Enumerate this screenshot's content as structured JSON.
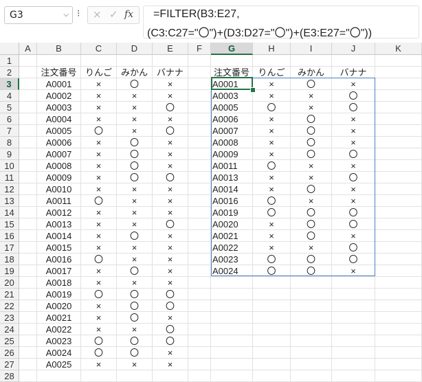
{
  "name_box": {
    "value": "G3",
    "chevron": "chevron-down-icon"
  },
  "formula_bar": {
    "menu_icon": "⁝",
    "cancel_icon": "×",
    "enter_icon": "✓",
    "fx_icon": "fx",
    "line1": "=FILTER(B3:E27,",
    "line2": "(C3:C27=\"〇\")+(D3:D27=\"〇\")+(E3:E27=\"〇\"))"
  },
  "column_headers": [
    "A",
    "B",
    "C",
    "D",
    "E",
    "F",
    "G",
    "H",
    "I",
    "J",
    "K"
  ],
  "selected_column": "G",
  "row_numbers": [
    "1",
    "2",
    "3",
    "4",
    "5",
    "6",
    "7",
    "8",
    "9",
    "10",
    "11",
    "12",
    "13",
    "14",
    "15",
    "16",
    "17",
    "18",
    "19",
    "20",
    "21",
    "22",
    "23",
    "24",
    "25",
    "26",
    "27",
    "28"
  ],
  "selected_row": "3",
  "source_table": {
    "headers": [
      "注文番号",
      "りんご",
      "みかん",
      "バナナ"
    ],
    "rows": [
      [
        "A0001",
        "×",
        "〇",
        "×"
      ],
      [
        "A0002",
        "×",
        "×",
        "×"
      ],
      [
        "A0003",
        "×",
        "×",
        "〇"
      ],
      [
        "A0004",
        "×",
        "×",
        "×"
      ],
      [
        "A0005",
        "〇",
        "×",
        "〇"
      ],
      [
        "A0006",
        "×",
        "〇",
        "×"
      ],
      [
        "A0007",
        "×",
        "〇",
        "×"
      ],
      [
        "A0008",
        "×",
        "〇",
        "×"
      ],
      [
        "A0009",
        "×",
        "〇",
        "〇"
      ],
      [
        "A0010",
        "×",
        "×",
        "×"
      ],
      [
        "A0011",
        "〇",
        "×",
        "×"
      ],
      [
        "A0012",
        "×",
        "×",
        "×"
      ],
      [
        "A0013",
        "×",
        "×",
        "〇"
      ],
      [
        "A0014",
        "×",
        "〇",
        "×"
      ],
      [
        "A0015",
        "×",
        "×",
        "×"
      ],
      [
        "A0016",
        "〇",
        "×",
        "×"
      ],
      [
        "A0017",
        "×",
        "〇",
        "×"
      ],
      [
        "A0018",
        "×",
        "×",
        "×"
      ],
      [
        "A0019",
        "〇",
        "〇",
        "〇"
      ],
      [
        "A0020",
        "×",
        "〇",
        "〇"
      ],
      [
        "A0021",
        "×",
        "〇",
        "×"
      ],
      [
        "A0022",
        "×",
        "×",
        "〇"
      ],
      [
        "A0023",
        "〇",
        "〇",
        "〇"
      ],
      [
        "A0024",
        "〇",
        "〇",
        "×"
      ],
      [
        "A0025",
        "×",
        "×",
        "×"
      ]
    ]
  },
  "filter_result": {
    "headers": [
      "注文番号",
      "りんご",
      "みかん",
      "バナナ"
    ],
    "rows": [
      [
        "A0001",
        "×",
        "〇",
        "×"
      ],
      [
        "A0003",
        "×",
        "×",
        "〇"
      ],
      [
        "A0005",
        "〇",
        "×",
        "〇"
      ],
      [
        "A0006",
        "×",
        "〇",
        "×"
      ],
      [
        "A0007",
        "×",
        "〇",
        "×"
      ],
      [
        "A0008",
        "×",
        "〇",
        "×"
      ],
      [
        "A0009",
        "×",
        "〇",
        "〇"
      ],
      [
        "A0011",
        "〇",
        "×",
        "×"
      ],
      [
        "A0013",
        "×",
        "×",
        "〇"
      ],
      [
        "A0014",
        "×",
        "〇",
        "×"
      ],
      [
        "A0016",
        "〇",
        "×",
        "×"
      ],
      [
        "A0019",
        "〇",
        "〇",
        "〇"
      ],
      [
        "A0020",
        "×",
        "〇",
        "〇"
      ],
      [
        "A0021",
        "×",
        "〇",
        "×"
      ],
      [
        "A0022",
        "×",
        "×",
        "〇"
      ],
      [
        "A0023",
        "〇",
        "〇",
        "〇"
      ],
      [
        "A0024",
        "〇",
        "〇",
        "×"
      ]
    ]
  },
  "colors": {
    "selection_green": "#217346",
    "spill_border": "#4a7fc1",
    "header_bg": "#f2f2f2"
  }
}
